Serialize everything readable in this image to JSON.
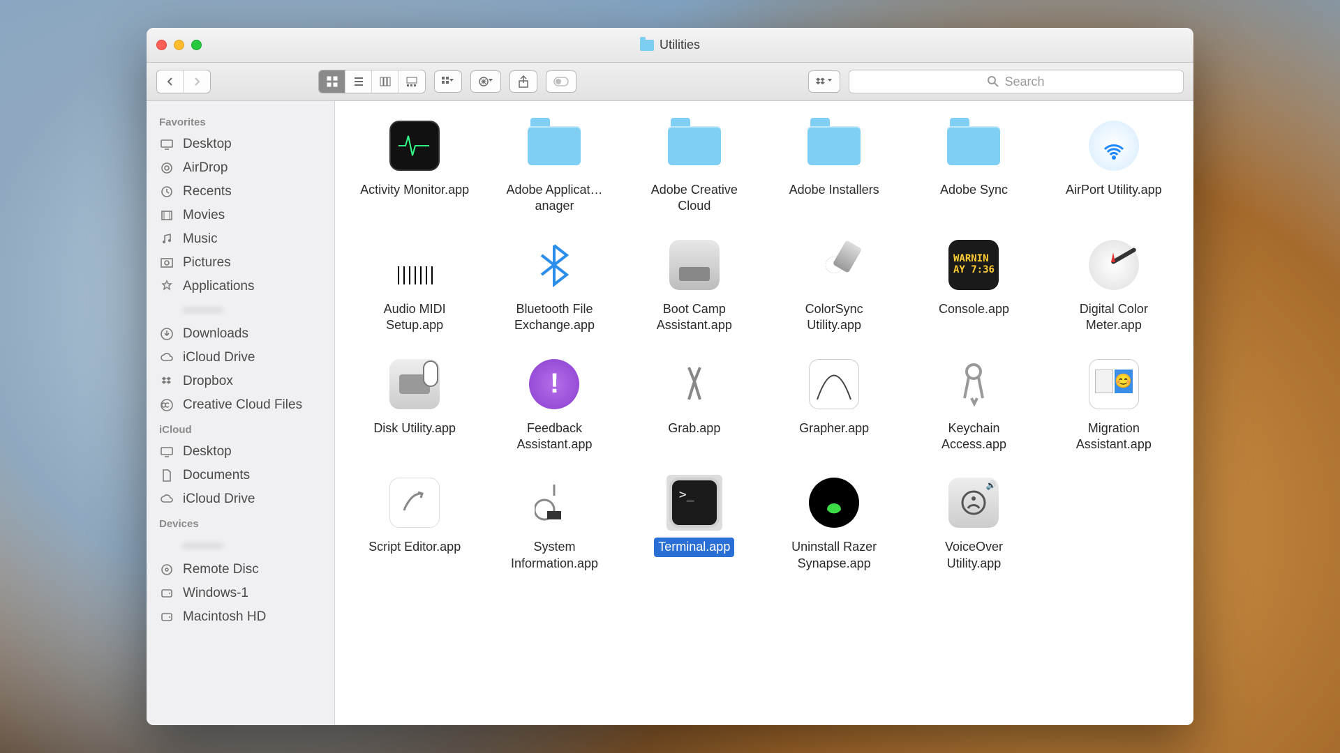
{
  "window": {
    "title": "Utilities"
  },
  "search": {
    "placeholder": "Search"
  },
  "sidebar": {
    "sections": [
      {
        "heading": "Favorites",
        "items": [
          {
            "label": "Desktop",
            "icon": "desktop"
          },
          {
            "label": "AirDrop",
            "icon": "airdrop"
          },
          {
            "label": "Recents",
            "icon": "recents"
          },
          {
            "label": "Movies",
            "icon": "movies"
          },
          {
            "label": "Music",
            "icon": "music"
          },
          {
            "label": "Pictures",
            "icon": "pictures"
          },
          {
            "label": "Applications",
            "icon": "applications"
          },
          {
            "label": "",
            "icon": "blur",
            "blurred": true
          },
          {
            "label": "Downloads",
            "icon": "downloads"
          },
          {
            "label": "iCloud Drive",
            "icon": "icloud"
          },
          {
            "label": "Dropbox",
            "icon": "dropbox"
          },
          {
            "label": "Creative Cloud Files",
            "icon": "cc"
          }
        ]
      },
      {
        "heading": "iCloud",
        "items": [
          {
            "label": "Desktop",
            "icon": "desktop"
          },
          {
            "label": "Documents",
            "icon": "documents"
          },
          {
            "label": "iCloud Drive",
            "icon": "icloud"
          }
        ]
      },
      {
        "heading": "Devices",
        "items": [
          {
            "label": "",
            "icon": "blur",
            "blurred": true
          },
          {
            "label": "Remote Disc",
            "icon": "disc"
          },
          {
            "label": "Windows-1",
            "icon": "hdd"
          },
          {
            "label": "Macintosh HD",
            "icon": "hdd"
          }
        ]
      }
    ]
  },
  "items": [
    {
      "label": "Activity Monitor.app",
      "icon": "activity"
    },
    {
      "label": "Adobe Applicat…anager",
      "icon": "folder"
    },
    {
      "label": "Adobe Creative Cloud",
      "icon": "folder"
    },
    {
      "label": "Adobe Installers",
      "icon": "folder"
    },
    {
      "label": "Adobe Sync",
      "icon": "folder"
    },
    {
      "label": "AirPort Utility.app",
      "icon": "airport"
    },
    {
      "label": "Audio MIDI Setup.app",
      "icon": "midi"
    },
    {
      "label": "Bluetooth File Exchange.app",
      "icon": "bluetooth"
    },
    {
      "label": "Boot Camp Assistant.app",
      "icon": "bootcamp"
    },
    {
      "label": "ColorSync Utility.app",
      "icon": "colorsync"
    },
    {
      "label": "Console.app",
      "icon": "console"
    },
    {
      "label": "Digital Color Meter.app",
      "icon": "colormeter"
    },
    {
      "label": "Disk Utility.app",
      "icon": "diskutil"
    },
    {
      "label": "Feedback Assistant.app",
      "icon": "feedback"
    },
    {
      "label": "Grab.app",
      "icon": "grab"
    },
    {
      "label": "Grapher.app",
      "icon": "grapher"
    },
    {
      "label": "Keychain Access.app",
      "icon": "keychain"
    },
    {
      "label": "Migration Assistant.app",
      "icon": "migration"
    },
    {
      "label": "Script Editor.app",
      "icon": "script"
    },
    {
      "label": "System Information.app",
      "icon": "sysinfo"
    },
    {
      "label": "Terminal.app",
      "icon": "terminal",
      "selected": true
    },
    {
      "label": "Uninstall Razer Synapse.app",
      "icon": "razer"
    },
    {
      "label": "VoiceOver Utility.app",
      "icon": "voiceover"
    }
  ]
}
